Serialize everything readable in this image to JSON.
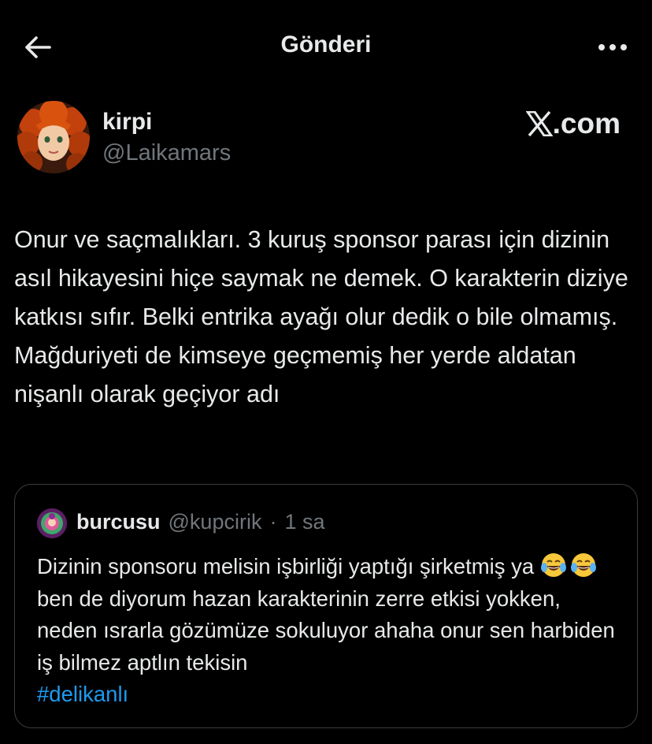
{
  "header": {
    "title": "Gönderi",
    "back_icon": "arrow-left-icon",
    "more_icon": "more-horizontal-icon"
  },
  "author": {
    "name": "kirpi",
    "handle": "@Laikamars"
  },
  "brand": {
    "label": ".com"
  },
  "post": {
    "text": "Onur ve saçmalıkları. 3 kuruş sponsor parası için dizinin asıl hikayesini hiçe saymak ne demek. O karakterin diziye katkısı sıfır. Belki entrika ayağı olur dedik o bile olmamış. Mağduriyeti de kimseye geçmemiş her yerde aldatan nişanlı olarak geçiyor adı"
  },
  "quote": {
    "name": "burcusu",
    "handle": "@kupcirik",
    "separator": "·",
    "time": "1 sa",
    "text_part1": "Dizinin sponsoru melisin işbirliği yaptığı şirketmiş ya",
    "emoji": "face-with-tears-of-joy-icon",
    "text_part2": "ben de diyorum hazan karakterinin zerre etkisi yokken, neden ısrarla gözümüze sokuluyor ahaha onur sen harbiden iş bilmez aptlın tekisin",
    "hashtag": "#delikanlı"
  },
  "colors": {
    "background": "#000000",
    "text": "#e7e9ea",
    "secondary": "#71767b",
    "link": "#1d9bf0",
    "border": "#3a3d40"
  }
}
